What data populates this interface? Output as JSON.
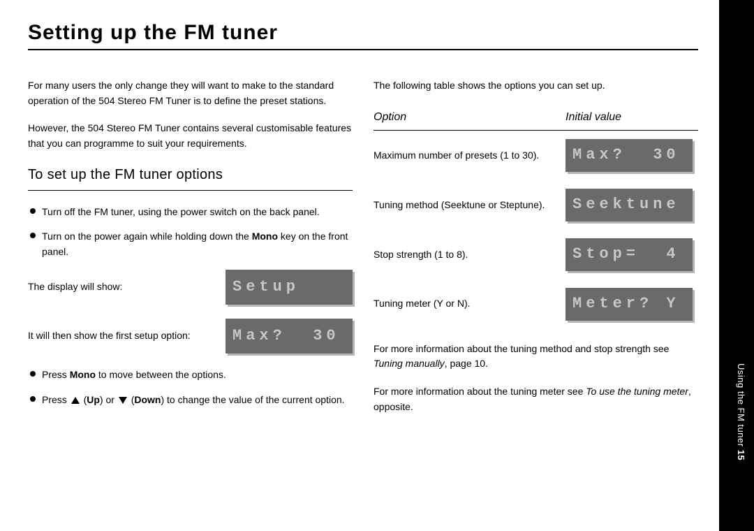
{
  "title": "Setting up the FM tuner",
  "side_label_plain": "Using the FM tuner",
  "side_label_bold": " 15",
  "page_number": "15",
  "intro": {
    "p1": "For many users the only change they will want to make to the standard operation of the 504 Stereo FM Tuner is to define the preset stations.",
    "p2": "However, the 504 Stereo FM Tuner contains several customisable features that you can programme to suit your requirements."
  },
  "subheading": "To set up the FM tuner options",
  "steps": {
    "b1": "Turn off the FM tuner, using the power switch on the back panel.",
    "b2_pre": "Turn on the power again while holding down the ",
    "b2_bold": "Mono",
    "b2_post": " key on the front panel.",
    "show_label": "The display will show:",
    "first_option_label": "It will then show the first setup option:",
    "b3_pre": "Press ",
    "b3_bold": "Mono",
    "b3_post": " to move between the options.",
    "b4_pre": "Press ",
    "b4_up": "Up",
    "b4_or": ") or ",
    "b4_down": "Down",
    "b4_post": ") to change the value of the current option."
  },
  "lcd": {
    "setup": "Setup",
    "max": "Max?  30",
    "seektune": "Seektune",
    "stop": "Stop=  4",
    "meter": "Meter? Y"
  },
  "right": {
    "intro": "The following table shows the options you can set up.",
    "th_option": "Option",
    "th_value": "Initial value",
    "r1": "Maximum number of presets (1 to 30).",
    "r2": "Tuning method (Seektune or Steptune).",
    "r3": "Stop strength (1 to 8).",
    "r4": "Tuning meter (Y or N).",
    "more1_pre": "For more information about the tuning method and stop strength see ",
    "more1_it": "Tuning manually",
    "more1_post": ", page 10.",
    "more2_pre": "For more information about the tuning meter see ",
    "more2_it": "To use the tuning meter",
    "more2_post": ", opposite."
  }
}
